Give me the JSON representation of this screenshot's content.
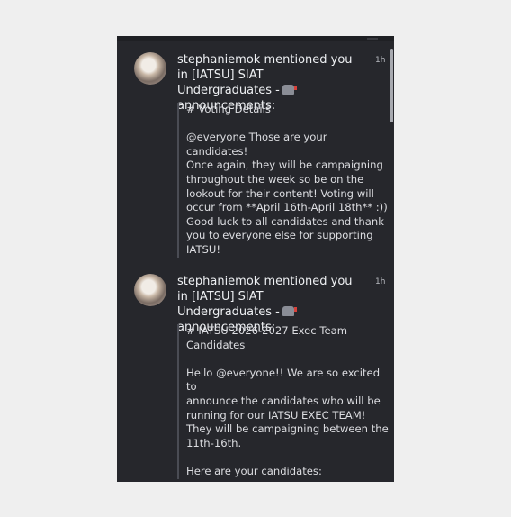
{
  "notifications": [
    {
      "header": "stephaniemok mentioned you in [IATSU] SIAT Undergraduates -",
      "header_end": "announcements:",
      "time": "1h",
      "lines": [
        "# Voting Details",
        "",
        "@everyone Those are your candidates!",
        "Once again, they will be campaigning",
        "throughout the week so be on the",
        "lookout for their content! Voting will",
        "occur from **April 16th-April 18th** :))",
        "Good luck to all candidates and thank",
        "you to everyone else for supporting",
        "IATSU!"
      ]
    },
    {
      "header": "stephaniemok mentioned you in [IATSU] SIAT Undergraduates -",
      "header_end": "announcements:",
      "time": "1h",
      "lines": [
        "# IATSU 2026-2027 Exec Team",
        "Candidates",
        "",
        "Hello @everyone!! We are so excited to",
        "announce the candidates who will be",
        "running for our IATSU EXEC TEAM!",
        "They will be campaigning between the",
        "11th-16th.",
        "",
        "Here are your candidates:"
      ]
    }
  ]
}
